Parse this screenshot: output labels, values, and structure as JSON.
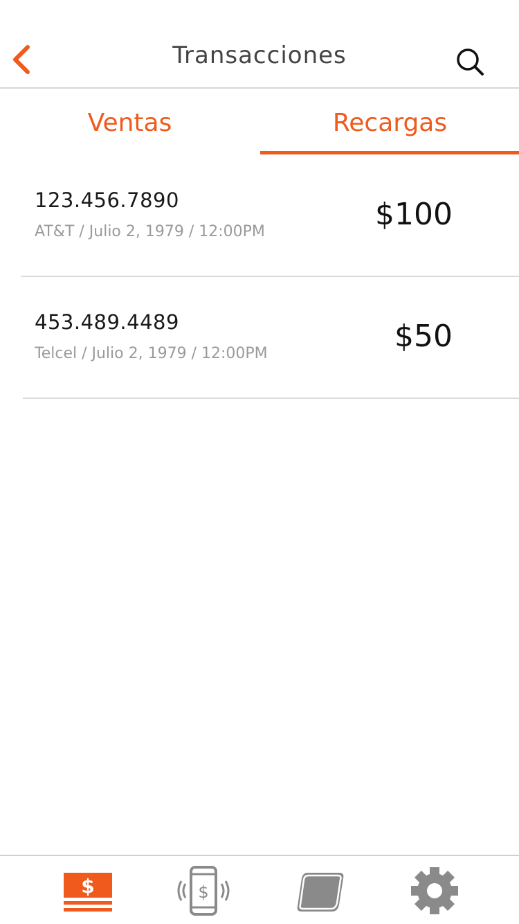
{
  "header": {
    "title": "Transacciones",
    "back_icon": "chevron-left-icon",
    "search_icon": "search-icon"
  },
  "tabs": [
    {
      "label": "Ventas",
      "active": false
    },
    {
      "label": "Recargas",
      "active": true
    }
  ],
  "transactions": [
    {
      "phone": "123.456.7890",
      "details": "AT&T / Julio 2, 1979 / 12:00PM",
      "amount": "$100"
    },
    {
      "phone": "453.489.4489",
      "details": "Telcel / Julio 2, 1979 / 12:00PM",
      "amount": "$50"
    }
  ],
  "bottom_nav": {
    "items": [
      {
        "name": "transactions-icon",
        "active": true
      },
      {
        "name": "phone-payment-icon",
        "active": false
      },
      {
        "name": "card-icon",
        "active": false
      },
      {
        "name": "settings-icon",
        "active": false
      }
    ]
  },
  "colors": {
    "accent": "#f05a1c",
    "inactive_icon": "#8a8a8a",
    "divider": "#d9d9d9"
  }
}
